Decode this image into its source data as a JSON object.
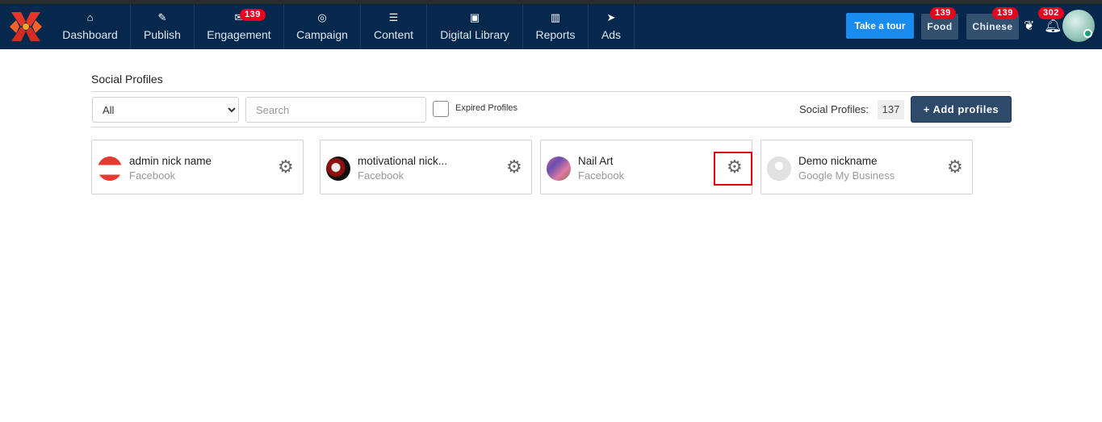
{
  "nav": {
    "items": [
      {
        "label": "Dashboard",
        "icon": "home-icon"
      },
      {
        "label": "Publish",
        "icon": "edit-icon"
      },
      {
        "label": "Engagement",
        "icon": "envelope-icon",
        "badge": "139"
      },
      {
        "label": "Campaign",
        "icon": "target-icon"
      },
      {
        "label": "Content",
        "icon": "list-icon"
      },
      {
        "label": "Digital Library",
        "icon": "briefcase-icon"
      },
      {
        "label": "Reports",
        "icon": "bar-chart-icon"
      },
      {
        "label": "Ads",
        "icon": "paper-plane-icon"
      }
    ],
    "tour_label": "Take a tour",
    "workspaces": [
      {
        "label": "Food",
        "badge": "139"
      },
      {
        "label": "Chinese",
        "badge": "139"
      }
    ],
    "notifications_badge": "302"
  },
  "page": {
    "title": "Social Profiles",
    "filter": {
      "selected": "All"
    },
    "search": {
      "placeholder": "Search",
      "value": ""
    },
    "expired_label": "Expired Profiles",
    "count_label": "Social Profiles:",
    "count": "137",
    "add_label": "+ Add profiles"
  },
  "profiles": [
    {
      "name": "admin nick name",
      "network": "Facebook"
    },
    {
      "name": "motivational nick...",
      "network": "Facebook"
    },
    {
      "name": "Nail Art",
      "network": "Facebook"
    },
    {
      "name": "Demo nickname",
      "network": "Google My Business"
    }
  ],
  "colors": {
    "nav": "#06284c",
    "accent": "#1a8cf0",
    "badge": "#e8001c",
    "highlight": "#e60012"
  }
}
